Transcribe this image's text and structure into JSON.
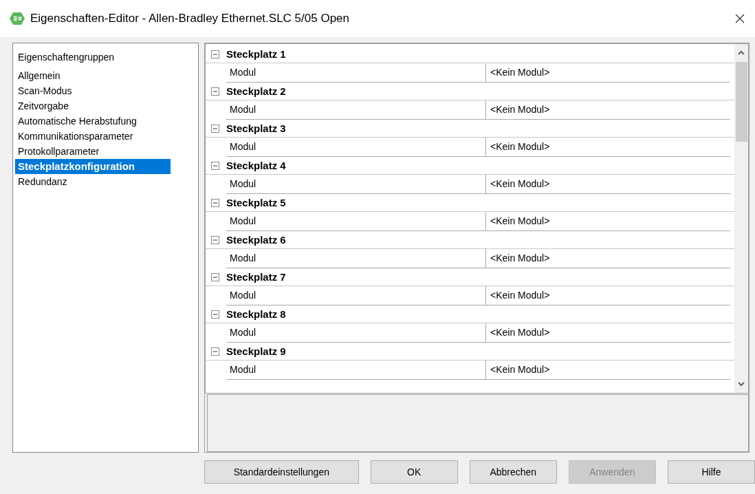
{
  "window": {
    "title": "Eigenschaften-Editor - Allen-Bradley Ethernet.SLC 5/05 Open"
  },
  "sidebar": {
    "heading": "Eigenschaftengruppen",
    "items": [
      {
        "label": "Allgemein",
        "selected": false
      },
      {
        "label": "Scan-Modus",
        "selected": false
      },
      {
        "label": "Zeitvorgabe",
        "selected": false
      },
      {
        "label": "Automatische Herabstufung",
        "selected": false
      },
      {
        "label": "Kommunikationsparameter",
        "selected": false
      },
      {
        "label": "Protokollparameter",
        "selected": false
      },
      {
        "label": "Steckplatzkonfiguration",
        "selected": true
      },
      {
        "label": "Redundanz",
        "selected": false
      }
    ]
  },
  "grid": {
    "groups": [
      {
        "title": "Steckplatz 1",
        "expanded": true,
        "properties": [
          {
            "name": "Modul",
            "value": "<Kein Modul>"
          }
        ]
      },
      {
        "title": "Steckplatz 2",
        "expanded": true,
        "properties": [
          {
            "name": "Modul",
            "value": "<Kein Modul>"
          }
        ]
      },
      {
        "title": "Steckplatz 3",
        "expanded": true,
        "properties": [
          {
            "name": "Modul",
            "value": "<Kein Modul>"
          }
        ]
      },
      {
        "title": "Steckplatz 4",
        "expanded": true,
        "properties": [
          {
            "name": "Modul",
            "value": "<Kein Modul>"
          }
        ]
      },
      {
        "title": "Steckplatz 5",
        "expanded": true,
        "properties": [
          {
            "name": "Modul",
            "value": "<Kein Modul>"
          }
        ]
      },
      {
        "title": "Steckplatz 6",
        "expanded": true,
        "properties": [
          {
            "name": "Modul",
            "value": "<Kein Modul>"
          }
        ]
      },
      {
        "title": "Steckplatz 7",
        "expanded": true,
        "properties": [
          {
            "name": "Modul",
            "value": "<Kein Modul>"
          }
        ]
      },
      {
        "title": "Steckplatz 8",
        "expanded": true,
        "properties": [
          {
            "name": "Modul",
            "value": "<Kein Modul>"
          }
        ]
      },
      {
        "title": "Steckplatz 9",
        "expanded": true,
        "properties": [
          {
            "name": "Modul",
            "value": "<Kein Modul>"
          }
        ]
      }
    ]
  },
  "buttons": [
    {
      "label": "Standardeinstellungen",
      "disabled": false
    },
    {
      "label": "OK",
      "disabled": false
    },
    {
      "label": "Abbrechen",
      "disabled": false
    },
    {
      "label": "Anwenden",
      "disabled": true
    },
    {
      "label": "Hilfe",
      "disabled": false
    }
  ]
}
